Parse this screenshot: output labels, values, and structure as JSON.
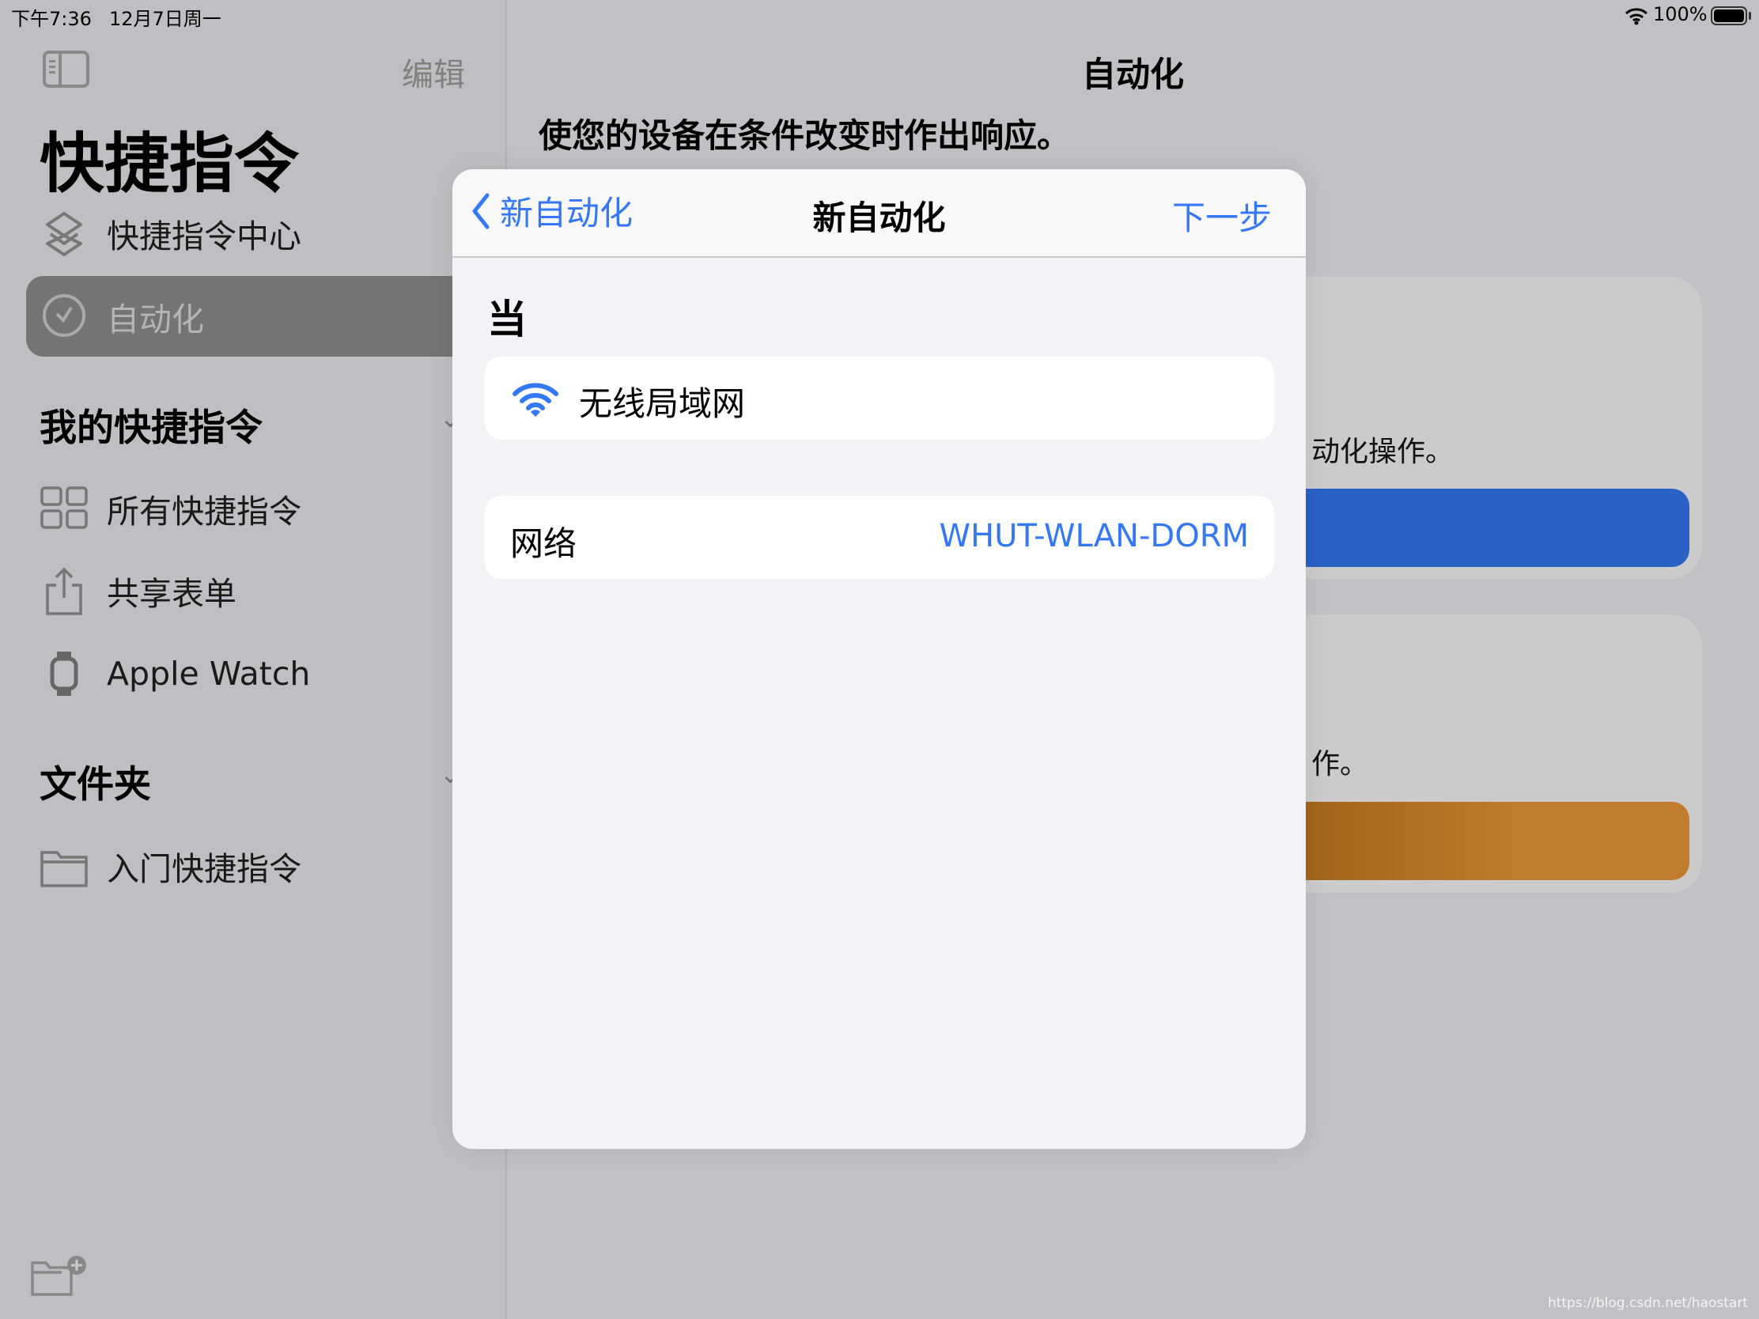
{
  "status_bar": {
    "time": "下午7:36",
    "date": "12月7日周一",
    "battery": "100%",
    "battery_level": 1.0
  },
  "sidebar": {
    "edit_label": "编辑",
    "title": "快捷指令",
    "items": [
      {
        "label": "快捷指令中心",
        "icon": "gallery-layers-icon"
      },
      {
        "label": "自动化",
        "icon": "clock-icon",
        "selected": true
      }
    ],
    "my_shortcuts_header": "我的快捷指令",
    "my_shortcuts": [
      {
        "label": "所有快捷指令",
        "icon": "grid-icon"
      },
      {
        "label": "共享表单",
        "icon": "share-icon"
      },
      {
        "label": "Apple Watch",
        "icon": "watch-icon"
      }
    ],
    "folders_header": "文件夹",
    "folders": [
      {
        "label": "入门快捷指令",
        "icon": "folder-icon"
      }
    ]
  },
  "main": {
    "title": "自动化",
    "subtitle": "使您的设备在条件改变时作出响应。",
    "card1_text": "动化操作。",
    "card2_text": "作。",
    "card1_button_color": "#2a62c5",
    "card2_button_color": "#c07b2c"
  },
  "modal": {
    "back_label": "新自动化",
    "title": "新自动化",
    "next_label": "下一步",
    "section_label": "当",
    "trigger_label": "无线局域网",
    "network_label": "网络",
    "network_value": "WHUT-WLAN-DORM",
    "accent": "#3478f6"
  },
  "watermark": "https://blog.csdn.net/haostart"
}
